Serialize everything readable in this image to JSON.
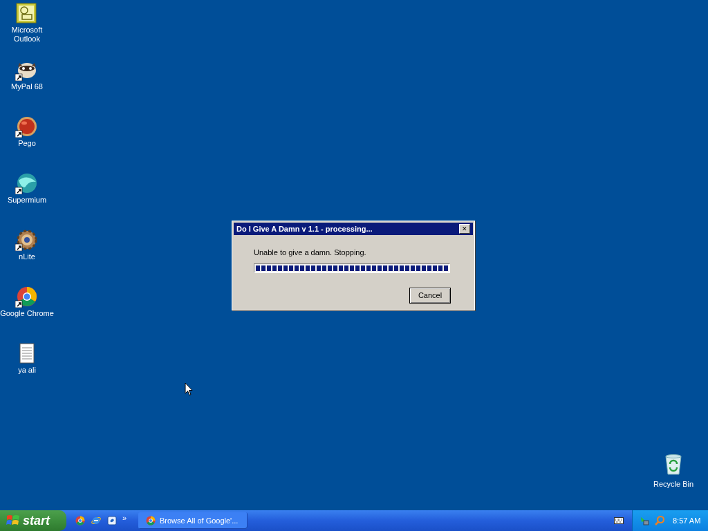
{
  "desktop_icons": [
    {
      "label": "Microsoft Outlook",
      "kind": "outlook",
      "shortcut": false
    },
    {
      "label": "MyPal 68",
      "kind": "raccoon",
      "shortcut": true
    },
    {
      "label": "Pego",
      "kind": "orb",
      "shortcut": true
    },
    {
      "label": "Supermium",
      "kind": "sphere",
      "shortcut": true
    },
    {
      "label": "nLite",
      "kind": "gear",
      "shortcut": true
    },
    {
      "label": "Google Chrome",
      "kind": "chrome",
      "shortcut": true
    },
    {
      "label": "ya ali",
      "kind": "notepad",
      "shortcut": false
    }
  ],
  "recycle_bin": {
    "label": "Recycle Bin"
  },
  "dialog": {
    "title": "Do I Give A Damn v 1.1 - processing...",
    "close": "✕",
    "message": "Unable to give a damn. Stopping.",
    "progress": {
      "level": 1
    },
    "button": "Cancel"
  },
  "taskbar": {
    "start": "start",
    "quick_launch": [
      {
        "kind": "chrome"
      },
      {
        "kind": "ie"
      },
      {
        "kind": "outlook-express"
      }
    ],
    "chevron": "»",
    "tasks": [
      {
        "label": "Browse All of Google'...",
        "selected": false
      }
    ],
    "clock": "8:57 AM"
  }
}
